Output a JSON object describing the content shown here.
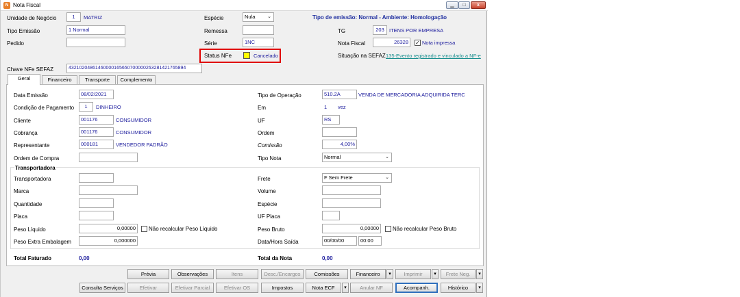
{
  "window": {
    "title": "Nota Fiscal",
    "app_icon": "app-logo-icon",
    "controls": {
      "minimize": "▁",
      "maximize": "□",
      "close": "x"
    }
  },
  "header": {
    "unidade_label": "Unidade de Negócio",
    "unidade_code": "1",
    "unidade_name": "MATRIZ",
    "tipo_emissao_label": "Tipo Emissão",
    "tipo_emissao_value": "1 Normal",
    "pedido_label": "Pedido",
    "pedido_value": "",
    "especie_label": "Espécie",
    "especie_value": "Nula",
    "remessa_label": "Remessa",
    "remessa_value": "",
    "serie_label": "Série",
    "serie_value": "1NC",
    "status_label": "Status NFe",
    "status_value": "Cancelado",
    "status_color": "#ffff00",
    "tipo_emissao_info": "Tipo de emissão: Normal - Ambiente: Homologação",
    "tg_label": "TG",
    "tg_code": "203",
    "tg_desc": "ITENS POR EMPRESA",
    "nota_fiscal_label": "Nota Fiscal",
    "nota_fiscal_value": "26328",
    "nota_impressa_label": "Nota impressa",
    "nota_impressa_checked": "✓",
    "situacao_label": "Situação na SEFAZ",
    "situacao_value": "135-Evento registrado e vinculado a NF-e",
    "chave_label": "Chave NFe SEFAZ",
    "chave_value": "43210204861460000165650700000263281421765894"
  },
  "tabs": [
    {
      "label": "Geral"
    },
    {
      "label": "Financeiro"
    },
    {
      "label": "Transporte"
    },
    {
      "label": "Complemento"
    }
  ],
  "geral": {
    "data_emissao_label": "Data Emissão",
    "data_emissao_value": "08/02/2021",
    "cond_pag_label": "Condição de Pagamento",
    "cond_pag_code": "1",
    "cond_pag_name": "DINHEIRO",
    "cliente_label": "Cliente",
    "cliente_code": "001176",
    "cliente_name": "CONSUMIDOR",
    "cobranca_label": "Cobrança",
    "cobranca_code": "001176",
    "cobranca_name": "CONSUMIDOR",
    "representante_label": "Representante",
    "representante_code": "000181",
    "representante_name": "VENDEDOR PADRÃO",
    "ordem_compra_label": "Ordem de Compra",
    "ordem_compra_value": "",
    "tipo_operacao_label": "Tipo de Operação",
    "tipo_operacao_code": "510.2A",
    "tipo_operacao_name": "VENDA DE MERCADORIA ADQUIRIDA TERC",
    "em_label": "Em",
    "em_value": "1",
    "em_unit": "vez",
    "uf_label": "UF",
    "uf_value": "RS",
    "ordem_label": "Ordem",
    "ordem_value": "",
    "comissao_label": "Comissão",
    "comissao_value": "4,00%",
    "tipo_nota_label": "Tipo Nota",
    "tipo_nota_value": "Normal"
  },
  "transportadora": {
    "group_title": "Transportadora",
    "transportadora_label": "Transportadora",
    "marca_label": "Marca",
    "quantidade_label": "Quantidade",
    "placa_label": "Placa",
    "peso_liquido_label": "Peso Líquido",
    "peso_liquido_value": "0,00000",
    "nao_recalc_liq_label": "Não recalcular Peso Líquido",
    "peso_extra_label": "Peso Extra Embalagem",
    "peso_extra_value": "0,000000",
    "frete_label": "Frete",
    "frete_value": "F Sem Frete",
    "volume_label": "Volume",
    "especie_label": "Espécie",
    "uf_placa_label": "UF Placa",
    "peso_bruto_label": "Peso Bruto",
    "peso_bruto_value": "0,00000",
    "nao_recalc_bruto_label": "Não recalcular Peso Bruto",
    "data_saida_label": "Data/Hora Saída",
    "data_saida_value": "00/00/00",
    "hora_saida_value": "00:00"
  },
  "totals": {
    "total_faturado_label": "Total Faturado",
    "total_faturado_value": "0,00",
    "total_nota_label": "Total da Nota",
    "total_nota_value": "0,00"
  },
  "buttons_row1": {
    "previa": "Prévia",
    "observacoes": "Observações",
    "itens": "Itens",
    "desc_encargos": "Desc./Encargos",
    "comissoes": "Comissões",
    "financeiro": "Financeiro",
    "imprimir": "Imprimir",
    "frete_neg": "Frete Neg."
  },
  "buttons_row2": {
    "consulta_servicos": "Consulta Serviços",
    "efetivar": "Efetivar",
    "efetivar_parcial": "Efetivar Parcial",
    "efetivar_os": "Efetivar OS",
    "impostos": "Impostos",
    "nota_ecf": "Nota ECF",
    "anular_nf": "Anular NF",
    "acompanh": "Acompanh.",
    "historico": "Histórico"
  },
  "dropdown_glyph": "▾"
}
